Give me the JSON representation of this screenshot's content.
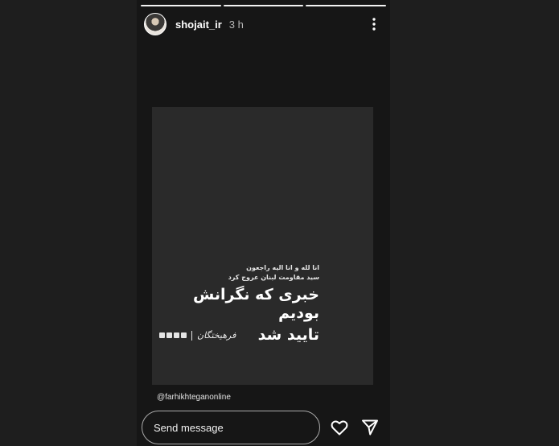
{
  "story": {
    "progress_segments": [
      "done",
      "done",
      "active"
    ],
    "username": "shojait_ir",
    "time": "3 h",
    "more_icon": "more-vertical-icon",
    "card": {
      "sub_line_1": "انا لله و انا الیه راجعون",
      "sub_line_2": "سید مقاومت لبنان عروج کرد",
      "title_line_1": "خبری که نگرانش بودیم",
      "title_line_2": "تایید شد",
      "brand_name": "فرهیختگان"
    },
    "mention": "@farhikhteganonline",
    "footer": {
      "message_placeholder": "Send message",
      "like_icon": "heart-icon",
      "share_icon": "send-icon"
    }
  }
}
